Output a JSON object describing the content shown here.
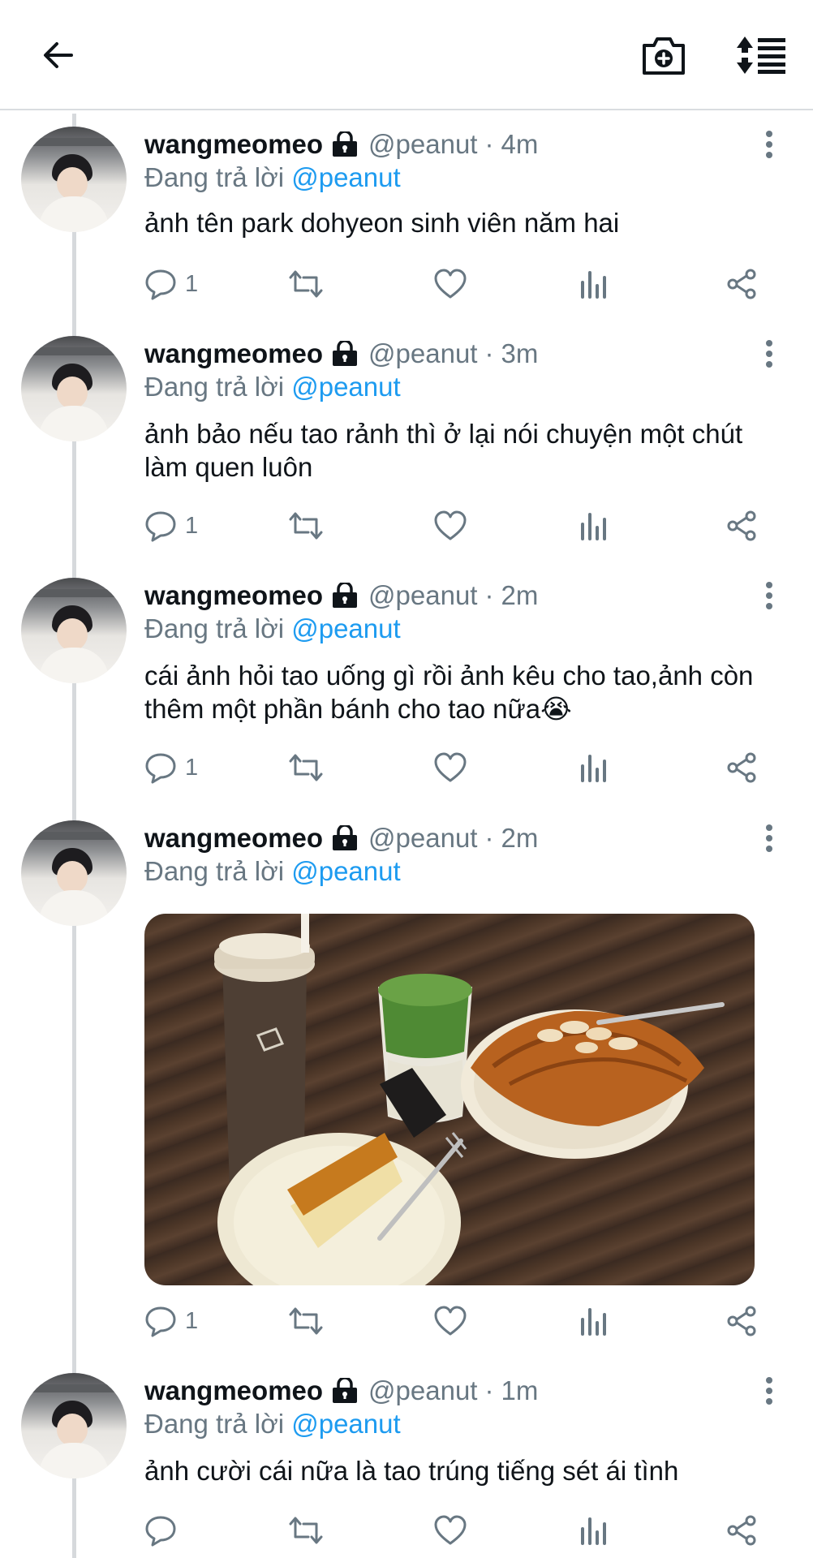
{
  "topbar": {
    "back_icon": "arrow-left-icon",
    "camera_icon": "camera-add-icon",
    "sort_icon": "sort-thread-icon"
  },
  "colors": {
    "text": "#0f1419",
    "secondary": "#687782",
    "link": "#1d9bf0",
    "divider": "#d9dde0",
    "thread_line": "#d6d9dc"
  },
  "tweets": [
    {
      "name": "wangmeomeo",
      "handle": "@peanut",
      "separator": "·",
      "time": "4m",
      "replying_prefix": "Đang trả lời",
      "replying_to": "@peanut",
      "text": "ảnh tên park dohyeon sinh viên năm hai",
      "reply_count": "1"
    },
    {
      "name": "wangmeomeo",
      "handle": "@peanut",
      "separator": "·",
      "time": "3m",
      "replying_prefix": "Đang trả lời",
      "replying_to": "@peanut",
      "text": "ảnh bảo nếu tao rảnh thì ở lại nói chuyện một chút làm quen luôn",
      "reply_count": "1"
    },
    {
      "name": "wangmeomeo",
      "handle": "@peanut",
      "separator": "·",
      "time": "2m",
      "replying_prefix": "Đang trả lời",
      "replying_to": "@peanut",
      "text": "cái ảnh hỏi tao uống gì rồi ảnh kêu cho tao,ảnh còn thêm một phần bánh cho tao nữa😭",
      "reply_count": "1"
    },
    {
      "name": "wangmeomeo",
      "handle": "@peanut",
      "separator": "·",
      "time": "2m",
      "replying_prefix": "Đang trả lời",
      "replying_to": "@peanut",
      "text": "",
      "reply_count": "1",
      "media": "photo-coffee-matcha-croissant-cake"
    },
    {
      "name": "wangmeomeo",
      "handle": "@peanut",
      "separator": "·",
      "time": "1m",
      "replying_prefix": "Đang trả lời",
      "replying_to": "@peanut",
      "text": "ảnh cười cái nữa là tao trúng tiếng sét ái tình",
      "reply_count": ""
    }
  ]
}
